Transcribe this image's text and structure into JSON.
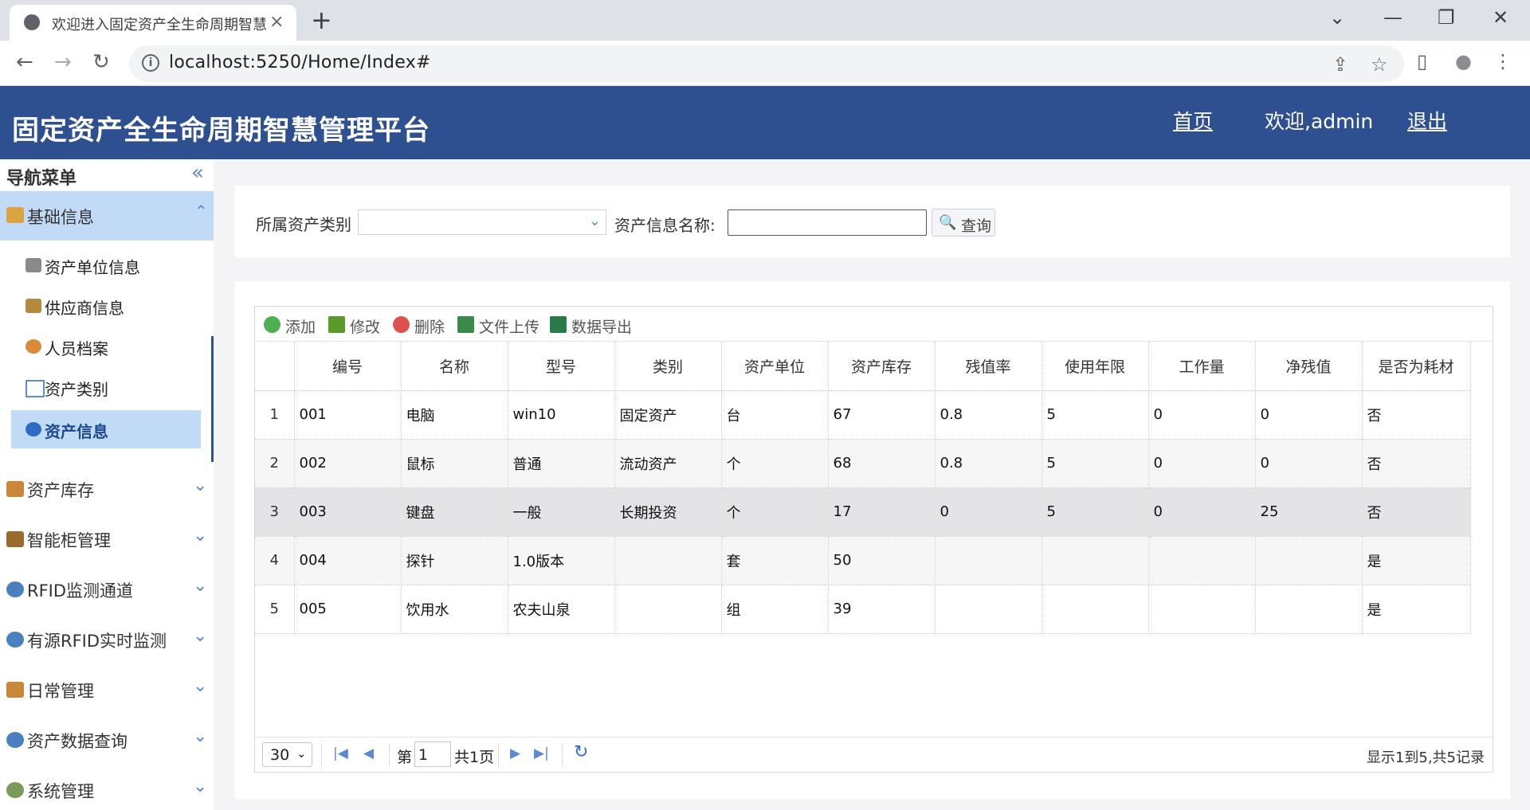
{
  "browser": {
    "tab_title": "欢迎进入固定资产全生命周期智慧管理平台",
    "url": "localhost:5250/Home/Index#",
    "tab_close": "×",
    "new_tab": "+",
    "win_icons": {
      "chevron": "⌄",
      "minimize": "—",
      "restore": "❐",
      "close": "✕"
    },
    "nav_icons": {
      "back": "←",
      "forward": "→",
      "reload": "↻"
    },
    "omni_icons": {
      "info": "i",
      "share": "⇪",
      "star": "☆",
      "sidepanel": "▯",
      "profile": "●",
      "menu": "⋮"
    }
  },
  "header": {
    "title": "固定资产全生命周期智慧管理平台",
    "home_link": "首页",
    "welcome": "欢迎,admin",
    "logout_link": "退出"
  },
  "sidebar": {
    "title": "导航菜单",
    "collapse_icon": "«",
    "expanded_group": {
      "label": "基础信息",
      "arrow": "⌃"
    },
    "sub_items": [
      {
        "label": "资产单位信息",
        "icon": "pencil-icon",
        "color": "#8a8a8a"
      },
      {
        "label": "供应商信息",
        "icon": "supplier-icon",
        "color": "#b58a3c"
      },
      {
        "label": "人员档案",
        "icon": "person-icon",
        "color": "#d98a3a"
      },
      {
        "label": "资产类别",
        "icon": "category-icon",
        "color": "#5a8fd0"
      },
      {
        "label": "资产信息",
        "icon": "info-icon",
        "color": "#2e6dc4",
        "active": true
      }
    ],
    "groups": [
      {
        "label": "资产库存",
        "icon": "house-icon",
        "color": "#c9873a"
      },
      {
        "label": "智能柜管理",
        "icon": "cabinet-icon",
        "color": "#9a6a2a"
      },
      {
        "label": "RFID监测通道",
        "icon": "magnifier-icon",
        "color": "#4a7fc0"
      },
      {
        "label": "有源RFID实时监测",
        "icon": "magnifier-icon",
        "color": "#4a7fc0"
      },
      {
        "label": "日常管理",
        "icon": "wrench-icon",
        "color": "#c9873a"
      },
      {
        "label": "资产数据查询",
        "icon": "magnifier-icon",
        "color": "#4a7fc0"
      },
      {
        "label": "系统管理",
        "icon": "gears-icon",
        "color": "#7a9a5a"
      }
    ],
    "group_arrow": "⌄"
  },
  "search": {
    "category_label": "所属资产类别",
    "category_value": "",
    "dropdown_arrow": "⌄",
    "name_label": "资产信息名称:",
    "name_value": "",
    "button_label": "查询",
    "button_icon": "🔍"
  },
  "toolbar": [
    {
      "label": "添加",
      "icon": "add-icon",
      "color": "#4caf50"
    },
    {
      "label": "修改",
      "icon": "edit-icon",
      "color": "#5a9a2a"
    },
    {
      "label": "删除",
      "icon": "delete-icon",
      "color": "#e05050"
    },
    {
      "label": "文件上传",
      "icon": "upload-icon",
      "color": "#3a8a4a"
    },
    {
      "label": "数据导出",
      "icon": "export-icon",
      "color": "#2a7a4a"
    }
  ],
  "table": {
    "columns": [
      "编号",
      "名称",
      "型号",
      "类别",
      "资产单位",
      "资产库存",
      "残值率",
      "使用年限",
      "工作量",
      "净残值",
      "是否为耗材"
    ],
    "rows": [
      [
        "1",
        "001",
        "电脑",
        "win10",
        "固定资产",
        "台",
        "67",
        "0.8",
        "5",
        "0",
        "0",
        "否"
      ],
      [
        "2",
        "002",
        "鼠标",
        "普通",
        "流动资产",
        "个",
        "68",
        "0.8",
        "5",
        "0",
        "0",
        "否"
      ],
      [
        "3",
        "003",
        "键盘",
        "一般",
        "长期投资",
        "个",
        "17",
        "0",
        "5",
        "0",
        "25",
        "否"
      ],
      [
        "4",
        "004",
        "探针",
        "1.0版本",
        "",
        "套",
        "50",
        "",
        "",
        "",
        "",
        "是"
      ],
      [
        "5",
        "005",
        "饮用水",
        "农夫山泉",
        "",
        "组",
        "39",
        "",
        "",
        "",
        "",
        "是"
      ]
    ]
  },
  "pager": {
    "page_size": "30",
    "size_arrow": "⌄",
    "first": "|◀",
    "prev": "◀",
    "page_prefix": "第",
    "current_page": "1",
    "page_of": "共1页",
    "next": "▶",
    "last": "▶|",
    "refresh": "↻",
    "info": "显示1到5,共5记录"
  },
  "colors": {
    "header_bg": "#2e5090",
    "accent": "#c1dbf7",
    "icon_blue": "#5c8ad1"
  }
}
